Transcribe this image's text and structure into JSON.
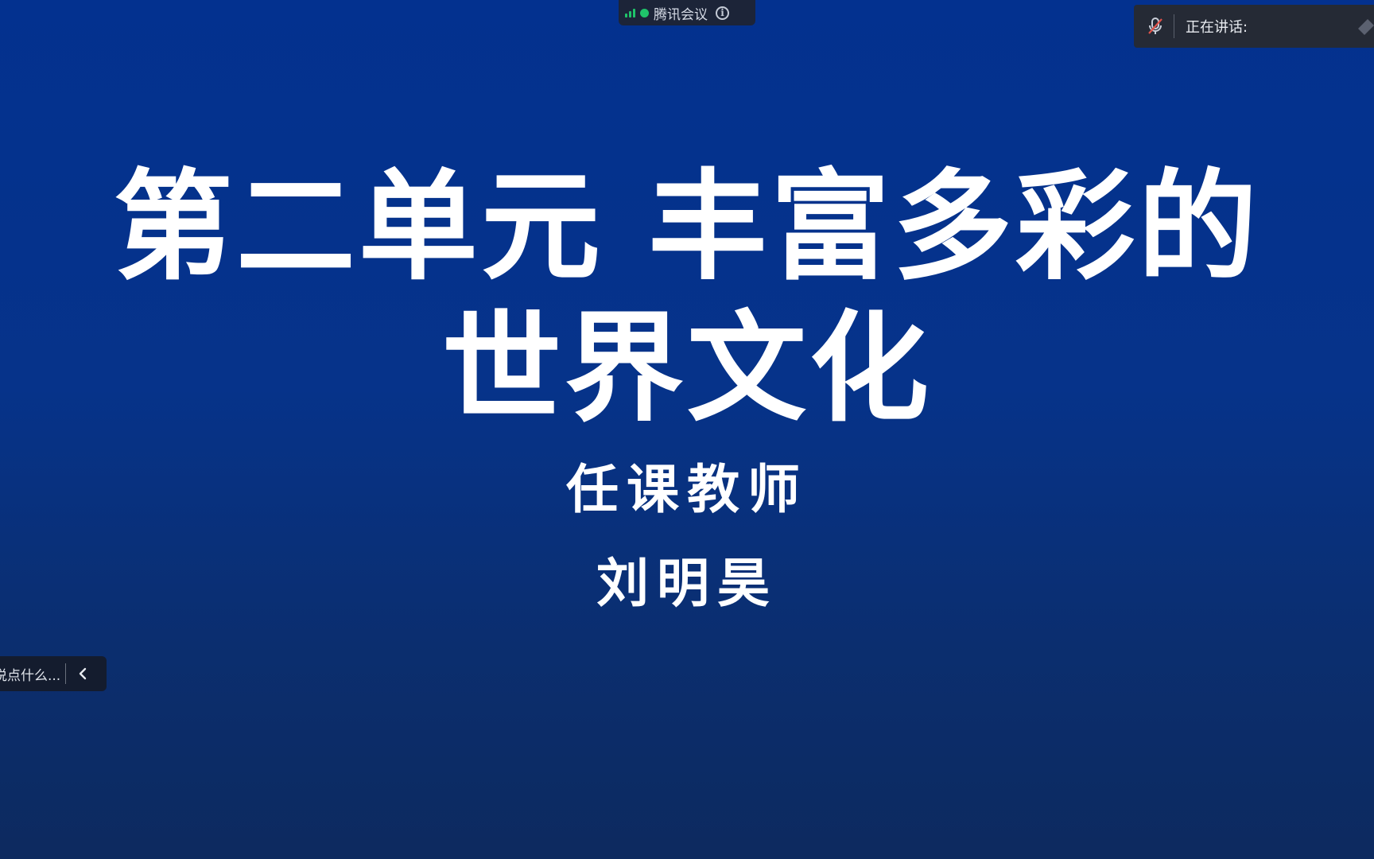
{
  "slide": {
    "title_line1": "第二单元 丰富多彩的",
    "title_line2": "世界文化",
    "teacher_label": "任课教师",
    "teacher_name": "刘明昊"
  },
  "meeting_bar": {
    "app_name": "腾讯会议",
    "signal_icon": "signal-bars-icon",
    "status_color": "#1fc36a",
    "info_icon": "info-icon"
  },
  "speaking_panel": {
    "label": "正在讲话:",
    "mic_icon": "mic-muted-icon"
  },
  "chat_bar": {
    "placeholder": "说点什么...",
    "collapse_icon": "chevron-left-icon"
  },
  "colors": {
    "slide_bg_top": "#03318f",
    "slide_bg_bottom": "#0d2a5f",
    "text": "#ffffff"
  }
}
